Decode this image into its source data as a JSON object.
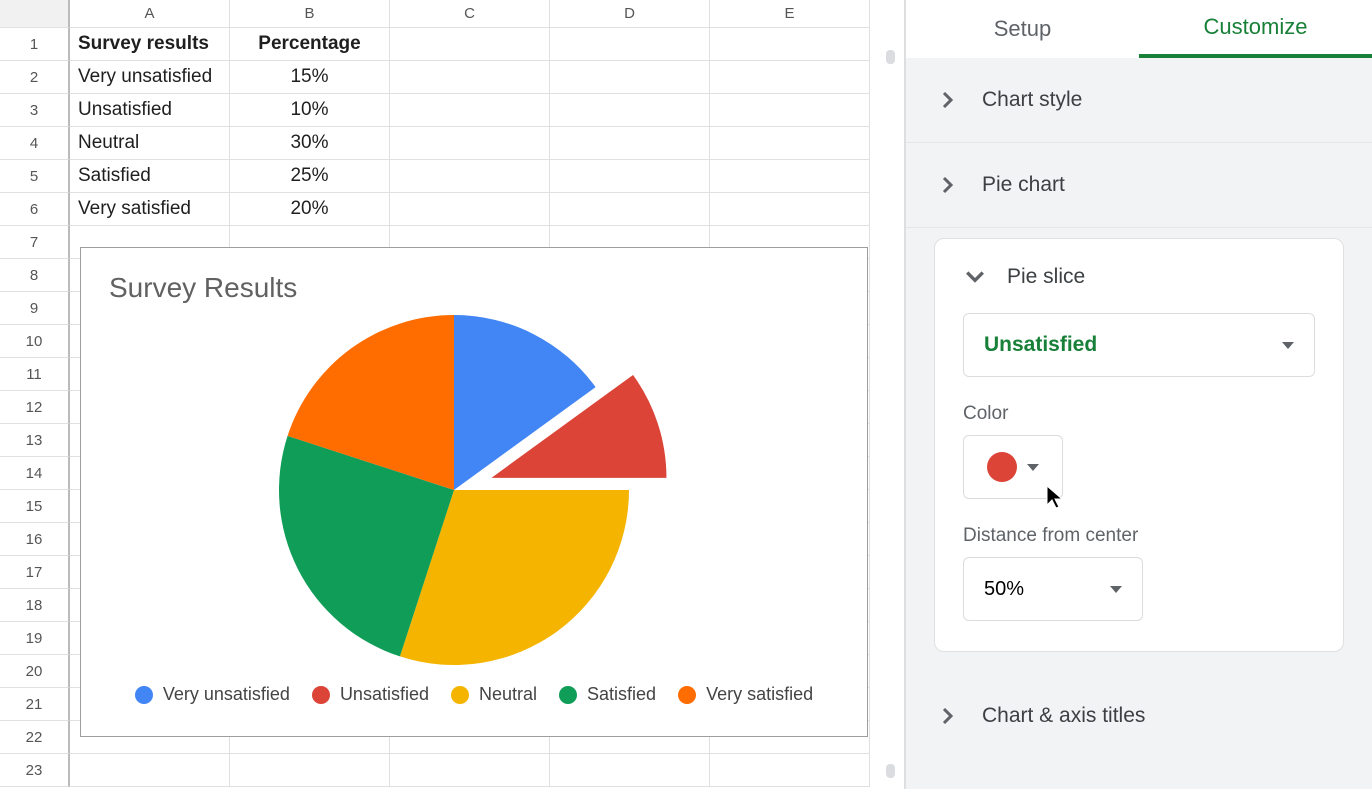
{
  "columns": [
    "A",
    "B",
    "C",
    "D",
    "E"
  ],
  "rows": [
    1,
    2,
    3,
    4,
    5,
    6,
    7,
    8,
    9,
    10,
    11,
    12,
    13,
    14,
    15,
    16,
    17,
    18,
    19,
    20,
    21,
    22,
    23
  ],
  "table": {
    "header": [
      "Survey results",
      "Percentage"
    ],
    "data": [
      [
        "Very unsatisfied",
        "15%"
      ],
      [
        "Unsatisfied",
        "10%"
      ],
      [
        "Neutral",
        "30%"
      ],
      [
        "Satisfied",
        "25%"
      ],
      [
        "Very satisfied",
        "20%"
      ]
    ]
  },
  "chart_data": {
    "type": "pie",
    "title": "Survey Results",
    "series": [
      {
        "name": "Very unsatisfied",
        "value": 15,
        "color": "#4285f4"
      },
      {
        "name": "Unsatisfied",
        "value": 10,
        "color": "#db4437",
        "explode": 0.5
      },
      {
        "name": "Neutral",
        "value": 30,
        "color": "#f4b400"
      },
      {
        "name": "Satisfied",
        "value": 25,
        "color": "#0f9d58"
      },
      {
        "name": "Very satisfied",
        "value": 20,
        "color": "#ff6d00"
      }
    ]
  },
  "sidebar": {
    "tabs": {
      "setup": "Setup",
      "customize": "Customize"
    },
    "sections": {
      "chart_style": "Chart style",
      "pie_chart": "Pie chart",
      "pie_slice": "Pie slice",
      "chart_axis_titles": "Chart & axis titles"
    },
    "pie_slice": {
      "selected": "Unsatisfied",
      "color_label": "Color",
      "color_value": "#db4437",
      "distance_label": "Distance from center",
      "distance_value": "50%"
    }
  }
}
